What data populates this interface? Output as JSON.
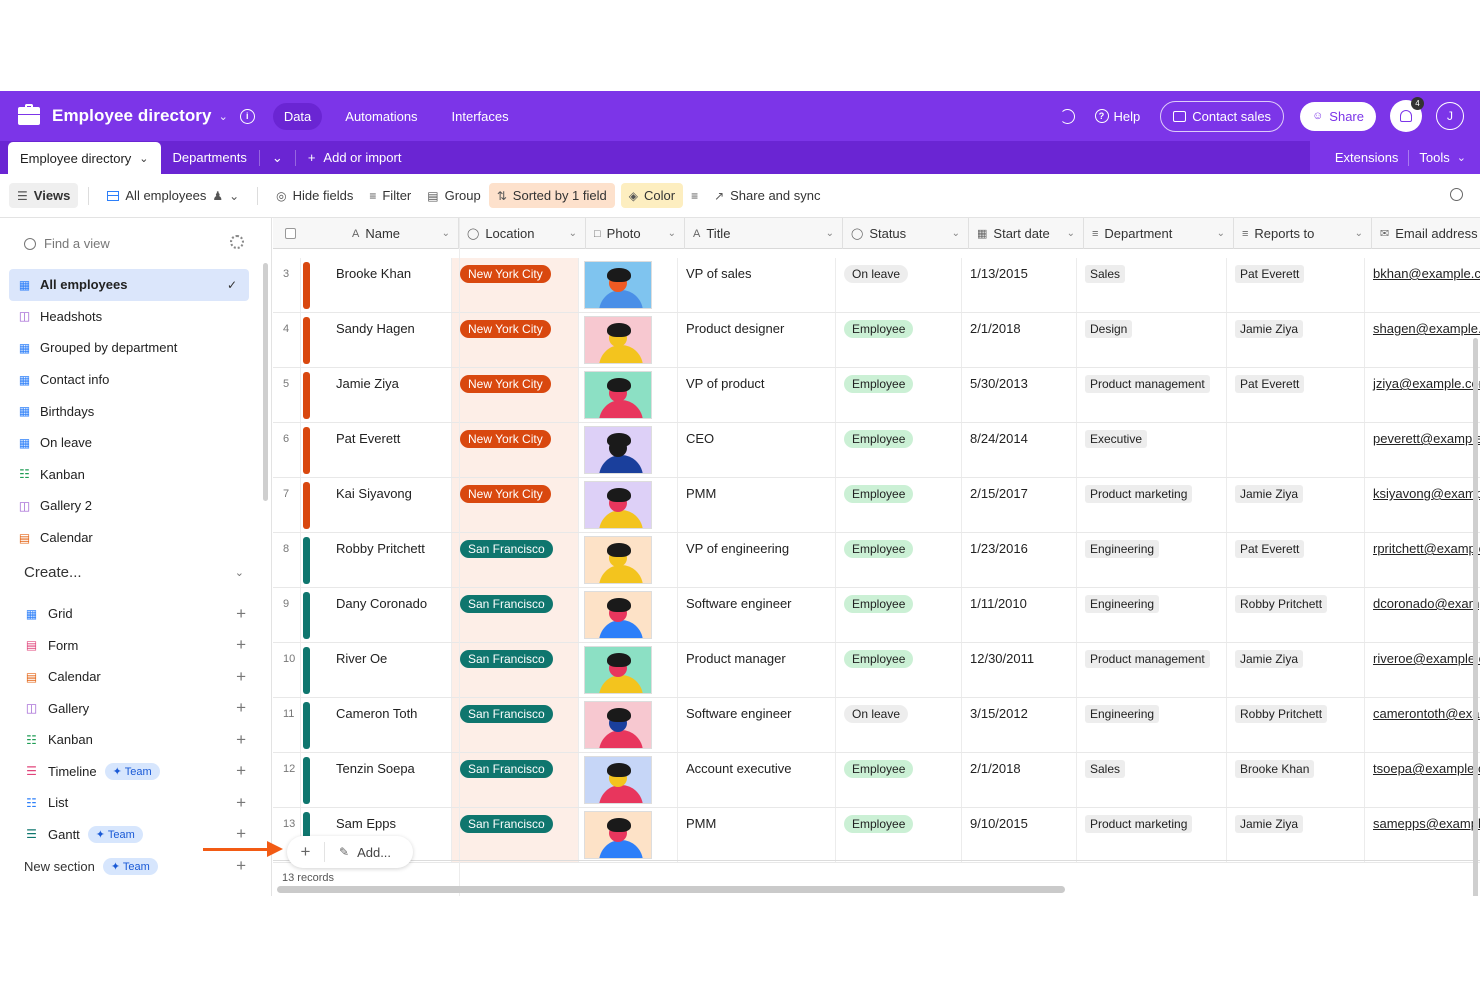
{
  "app": {
    "title": "Employee directory",
    "nav_tabs": [
      "Data",
      "Automations",
      "Interfaces"
    ],
    "help_label": "Help",
    "contact_label": "Contact sales",
    "share_label": "Share",
    "notification_count": "4",
    "avatar_initial": "J"
  },
  "table_tabs": {
    "active": "Employee directory",
    "other": "Departments",
    "add_import": "Add or import",
    "extensions": "Extensions",
    "tools": "Tools"
  },
  "toolbar": {
    "views": "Views",
    "current_view": "All employees",
    "hide_fields": "Hide fields",
    "filter": "Filter",
    "group": "Group",
    "sorted": "Sorted by 1 field",
    "color": "Color",
    "share_sync": "Share and sync"
  },
  "sidebar": {
    "find_placeholder": "Find a view",
    "views": [
      {
        "label": "All employees",
        "icon": "grid-icon"
      },
      {
        "label": "Headshots",
        "icon": "gallery-icon"
      },
      {
        "label": "Grouped by department",
        "icon": "grid-icon"
      },
      {
        "label": "Contact info",
        "icon": "grid-icon"
      },
      {
        "label": "Birthdays",
        "icon": "grid-icon"
      },
      {
        "label": "On leave",
        "icon": "grid-icon"
      },
      {
        "label": "Kanban",
        "icon": "kanban-icon"
      },
      {
        "label": "Gallery 2",
        "icon": "gallery-icon"
      },
      {
        "label": "Calendar",
        "icon": "calendar-icon"
      }
    ],
    "create_label": "Create...",
    "create_items": [
      {
        "label": "Grid",
        "team": ""
      },
      {
        "label": "Form",
        "team": ""
      },
      {
        "label": "Calendar",
        "team": ""
      },
      {
        "label": "Gallery",
        "team": ""
      },
      {
        "label": "Kanban",
        "team": ""
      },
      {
        "label": "Timeline",
        "team": "Team"
      },
      {
        "label": "List",
        "team": ""
      },
      {
        "label": "Gantt",
        "team": "Team"
      }
    ],
    "new_section": "New section",
    "new_section_team": "Team"
  },
  "grid": {
    "columns": [
      "Name",
      "Location",
      "Photo",
      "Title",
      "Status",
      "Start date",
      "Department",
      "Reports to",
      "Email address"
    ],
    "rows": [
      {
        "num": "3",
        "name": "Brooke Khan",
        "location": "New York City",
        "title": "VP of sales",
        "status": "On leave",
        "start": "1/13/2015",
        "dept": "Sales",
        "reports": "Pat Everett",
        "email": "bkhan@example.com"
      },
      {
        "num": "4",
        "name": "Sandy Hagen",
        "location": "New York City",
        "title": "Product designer",
        "status": "Employee",
        "start": "2/1/2018",
        "dept": "Design",
        "reports": "Jamie Ziya",
        "email": "shagen@example.com"
      },
      {
        "num": "5",
        "name": "Jamie Ziya",
        "location": "New York City",
        "title": "VP of product",
        "status": "Employee",
        "start": "5/30/2013",
        "dept": "Product management",
        "reports": "Pat Everett",
        "email": "jziya@example.com"
      },
      {
        "num": "6",
        "name": "Pat Everett",
        "location": "New York City",
        "title": "CEO",
        "status": "Employee",
        "start": "8/24/2014",
        "dept": "Executive",
        "reports": "",
        "email": "peverett@example.com"
      },
      {
        "num": "7",
        "name": "Kai Siyavong",
        "location": "New York City",
        "title": "PMM",
        "status": "Employee",
        "start": "2/15/2017",
        "dept": "Product marketing",
        "reports": "Jamie Ziya",
        "email": "ksiyavong@example.com"
      },
      {
        "num": "8",
        "name": "Robby Pritchett",
        "location": "San Francisco",
        "title": "VP of engineering",
        "status": "Employee",
        "start": "1/23/2016",
        "dept": "Engineering",
        "reports": "Pat Everett",
        "email": "rpritchett@example.com"
      },
      {
        "num": "9",
        "name": "Dany Coronado",
        "location": "San Francisco",
        "title": "Software engineer",
        "status": "Employee",
        "start": "1/11/2010",
        "dept": "Engineering",
        "reports": "Robby Pritchett",
        "email": "dcoronado@example.com"
      },
      {
        "num": "10",
        "name": "River Oe",
        "location": "San Francisco",
        "title": "Product manager",
        "status": "Employee",
        "start": "12/30/2011",
        "dept": "Product management",
        "reports": "Jamie Ziya",
        "email": "riveroe@example.com"
      },
      {
        "num": "11",
        "name": "Cameron Toth",
        "location": "San Francisco",
        "title": "Software engineer",
        "status": "On leave",
        "start": "3/15/2012",
        "dept": "Engineering",
        "reports": "Robby Pritchett",
        "email": "camerontoth@example.com"
      },
      {
        "num": "12",
        "name": "Tenzin Soepa",
        "location": "San Francisco",
        "title": "Account executive",
        "status": "Employee",
        "start": "2/1/2018",
        "dept": "Sales",
        "reports": "Brooke Khan",
        "email": "tsoepa@example.com"
      },
      {
        "num": "13",
        "name": "Sam Epps",
        "location": "San Francisco",
        "title": "PMM",
        "status": "Employee",
        "start": "9/10/2015",
        "dept": "Product marketing",
        "reports": "Jamie Ziya",
        "email": "samepps@example.com"
      }
    ],
    "add_label": "Add...",
    "records_label": "13 records"
  },
  "colors": {
    "brand": "#7c35e8",
    "nyc": "#d9480f",
    "sf": "#0f766e",
    "employee_status": "#cbf0d5",
    "on_leave_status": "#ededed"
  }
}
